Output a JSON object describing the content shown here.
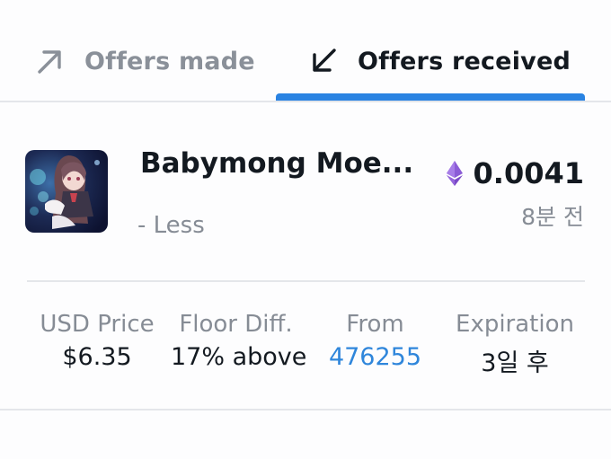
{
  "tabs": {
    "made_label": "Offers made",
    "received_label": "Offers received",
    "made_icon": "arrow-up-right-icon",
    "received_icon": "arrow-down-left-icon",
    "active": "received"
  },
  "offer": {
    "title": "Babymong Moe...",
    "subtitle": "- Less",
    "currency_icon": "ethereum-icon",
    "price": "0.0041",
    "time": "8분 전"
  },
  "stats": {
    "usd_label": "USD Price",
    "usd_value": "$6.35",
    "floor_label": "Floor Diff.",
    "floor_value": "17% above",
    "from_label": "From",
    "from_value": "476255",
    "expiration_label": "Expiration",
    "expiration_value": "3일 후"
  },
  "colors": {
    "accent": "#2a83e2",
    "link": "#2f86db",
    "muted": "#868c95",
    "text": "#131920",
    "divider": "#e4e6ea"
  }
}
